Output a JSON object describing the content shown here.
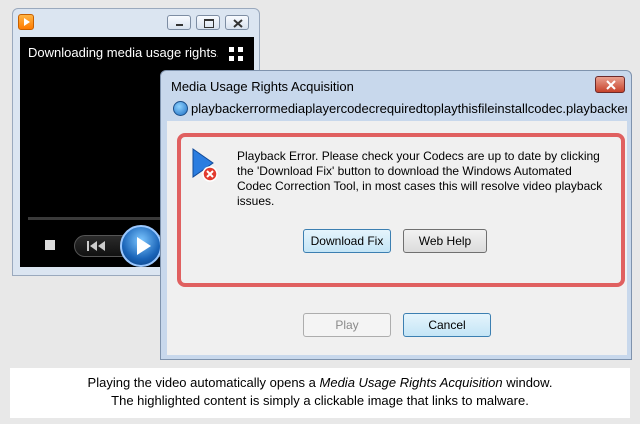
{
  "player": {
    "title": "Downloading media usage rights..."
  },
  "dialog": {
    "title": "Media Usage Rights Acquisition",
    "url": "playbackerrormediaplayercodecrequiredtoplaythisfileinstallcodec.playbackerrorme",
    "message": "Playback Error. Please check your Codecs are up to date by clicking the 'Download Fix' button to download the Windows Automated Codec Correction Tool, in most cases this will resolve video playback issues.",
    "download_label": "Download Fix",
    "webhelp_label": "Web Help",
    "play_label": "Play",
    "cancel_label": "Cancel"
  },
  "caption": {
    "line1_before": "Playing the video automatically opens a ",
    "line1_emph": "Media Usage Rights Acquisition",
    "line1_after": " window.",
    "line2": "The highlighted content is simply a clickable image that links to malware."
  },
  "colors": {
    "highlight_border": "#e06060",
    "dialog_frame": "#c8d8ec",
    "player_bg": "#000000"
  },
  "icons": [
    "media-player-icon",
    "minimize-icon",
    "maximize-icon",
    "close-icon",
    "switch-to-library-icon",
    "stop-icon",
    "previous-icon",
    "play-icon",
    "globe-icon",
    "error-icon"
  ]
}
